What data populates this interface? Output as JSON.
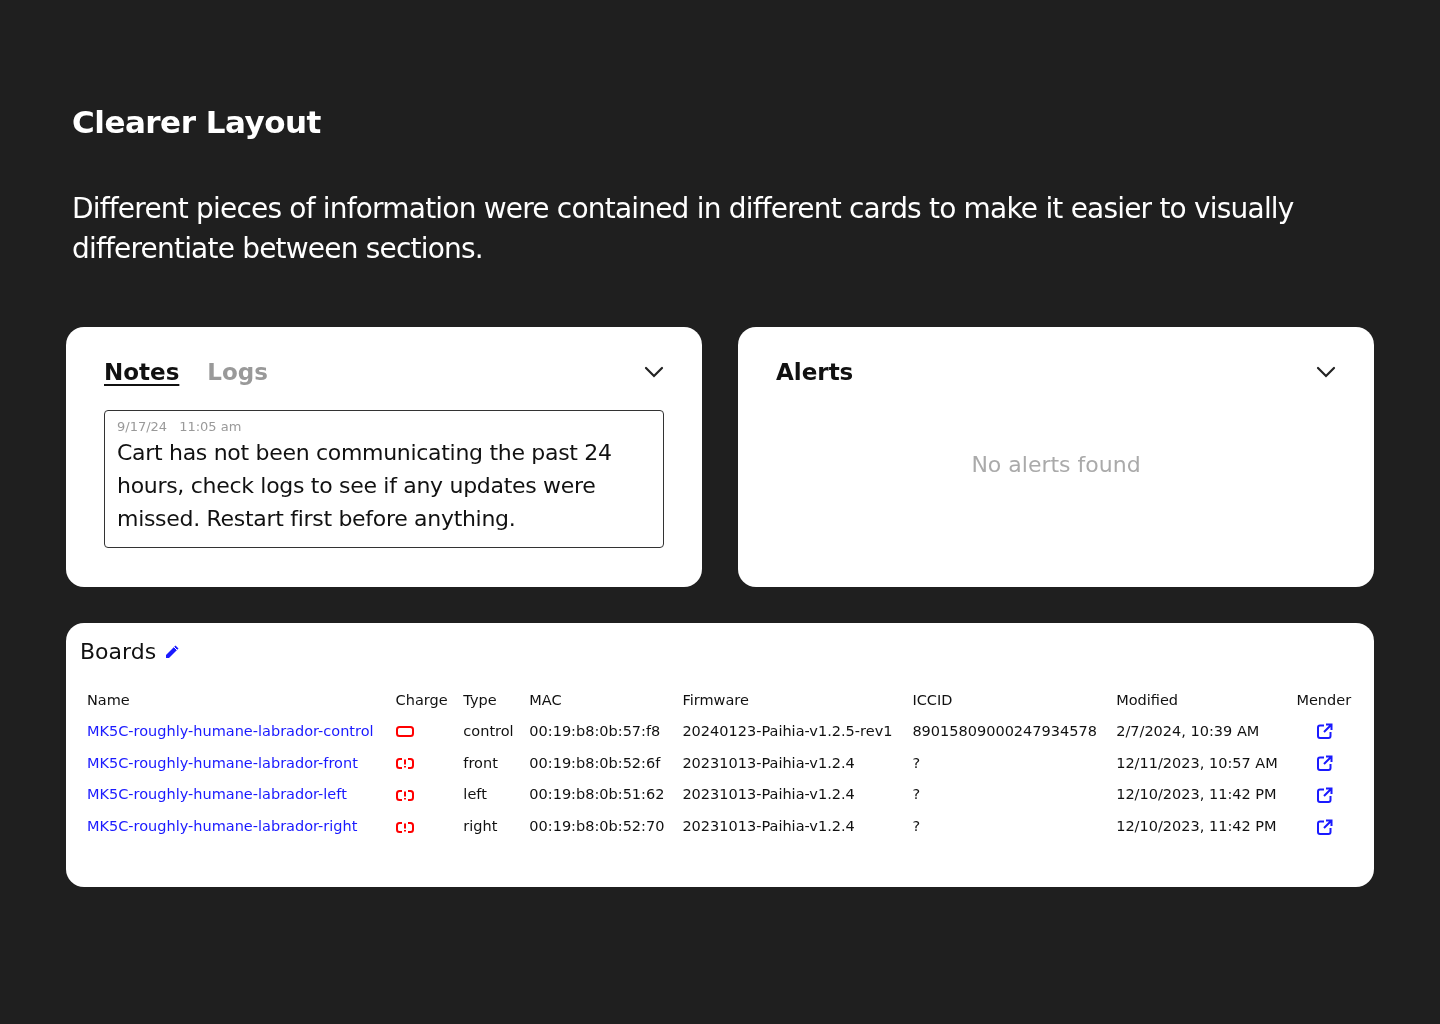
{
  "heading": "Clearer Layout",
  "description": "Different pieces of information were contained in different cards to make it easier to visually differentiate between sections.",
  "notes_card": {
    "tabs": [
      {
        "label": "Notes",
        "selected": true
      },
      {
        "label": "Logs",
        "selected": false
      }
    ],
    "notes": [
      {
        "date": "9/17/24",
        "time": "11:05 am",
        "text": "Cart has not been communicating the past 24 hours, check logs to see if any updates were missed. Restart first before anything."
      }
    ]
  },
  "alerts_card": {
    "title": "Alerts",
    "empty_message": "No alerts found"
  },
  "boards": {
    "title": "Boards",
    "columns": [
      "Name",
      "Charge",
      "Type",
      "MAC",
      "Firmware",
      "ICCID",
      "Modified",
      "Mender"
    ],
    "rows": [
      {
        "name": "MK5C-roughly-humane-labrador-control",
        "kind": "empty",
        "type": "control",
        "mac": "00:19:b8:0b:57:f8",
        "firmware": "20240123-Paihia-v1.2.5-rev1",
        "iccid": "89015809000247934578",
        "modified": "2/7/2024, 10:39 AM"
      },
      {
        "name": "MK5C-roughly-humane-labrador-front",
        "kind": "alert",
        "type": "front",
        "mac": "00:19:b8:0b:52:6f",
        "firmware": "20231013-Paihia-v1.2.4",
        "iccid": "?",
        "modified": "12/11/2023, 10:57 AM"
      },
      {
        "name": "MK5C-roughly-humane-labrador-left",
        "kind": "alert",
        "type": "left",
        "mac": "00:19:b8:0b:51:62",
        "firmware": "20231013-Paihia-v1.2.4",
        "iccid": "?",
        "modified": "12/10/2023, 11:42 PM"
      },
      {
        "name": "MK5C-roughly-humane-labrador-right",
        "kind": "alert",
        "type": "right",
        "mac": "00:19:b8:0b:52:70",
        "firmware": "20231013-Paihia-v1.2.4",
        "iccid": "?",
        "modified": "12/10/2023, 11:42 PM"
      }
    ]
  }
}
